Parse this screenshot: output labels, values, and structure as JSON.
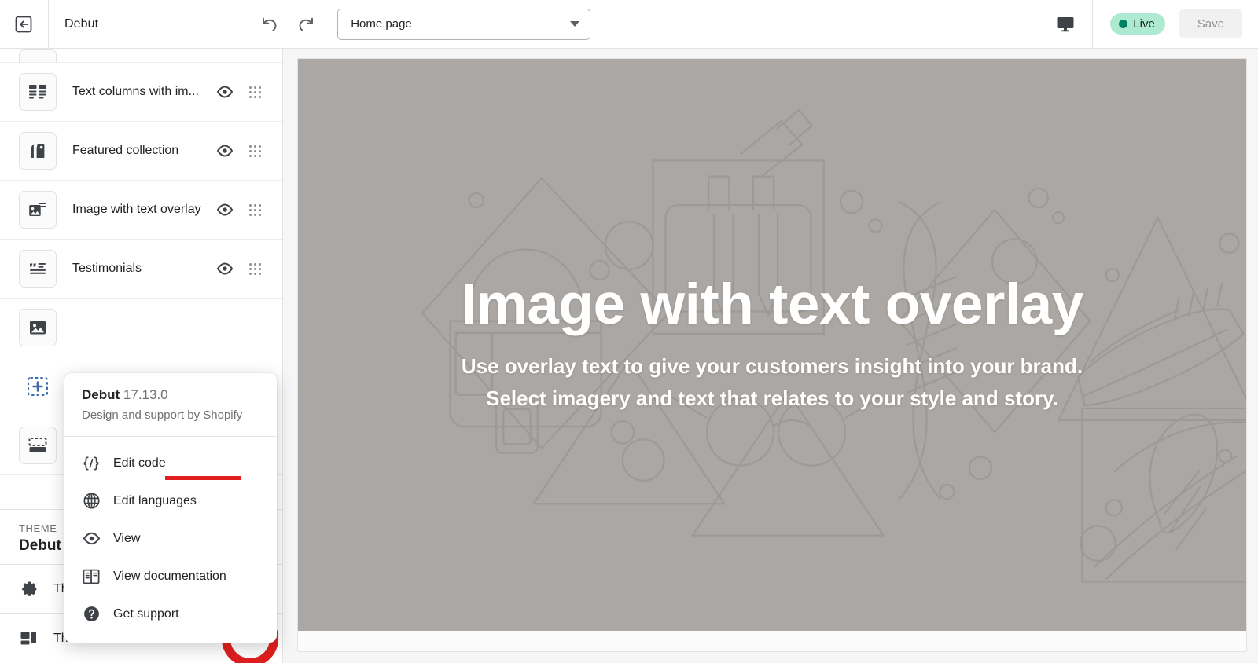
{
  "header": {
    "back_icon": "back-arrow-icon",
    "title": "Debut",
    "undo_icon": "undo-icon",
    "redo_icon": "redo-icon",
    "page_select": {
      "value": "Home page",
      "caret_icon": "chevron-down-icon"
    },
    "device_icon": "desktop-monitor-icon",
    "status": {
      "label": "Live",
      "color": "#008060",
      "background": "#aee9d1"
    },
    "save_label": "Save"
  },
  "sidebar": {
    "sections": [
      {
        "label": "",
        "icon": "slideshow-icon",
        "eye_icon": "eye-icon",
        "grip_icon": "drag-handle-icon",
        "clipped": true
      },
      {
        "label": "Text columns with im...",
        "icon": "text-columns-icon",
        "eye_icon": "eye-icon",
        "grip_icon": "drag-handle-icon"
      },
      {
        "label": "Featured collection",
        "icon": "tag-collection-icon",
        "eye_icon": "eye-icon",
        "grip_icon": "drag-handle-icon"
      },
      {
        "label": "Image with text overlay",
        "icon": "image-with-text-icon",
        "eye_icon": "eye-icon",
        "grip_icon": "drag-handle-icon"
      },
      {
        "label": "Testimonials",
        "icon": "quote-testimonial-icon",
        "eye_icon": "eye-icon",
        "grip_icon": "drag-handle-icon"
      },
      {
        "label": "",
        "icon": "image-icon",
        "eye_icon": "eye-icon",
        "grip_icon": "drag-handle-icon"
      },
      {
        "label": "",
        "icon": "add-section-icon",
        "eye_icon": "",
        "grip_icon": ""
      },
      {
        "label": "",
        "icon": "footer-icon",
        "eye_icon": "",
        "grip_icon": ""
      }
    ],
    "theme": {
      "eyebrow": "THEME",
      "name": "Debut",
      "settings_label": "Th",
      "settings_icon": "gear-icon",
      "actions_label": "Theme actions",
      "actions_icon": "theme-actions-icon",
      "ellipsis_icon": "ellipsis-horizontal-icon"
    }
  },
  "popover": {
    "theme_name": "Debut",
    "version": "17.13.0",
    "subtitle": "Design and support by Shopify",
    "items": [
      {
        "label": "Edit code",
        "icon": "code-braces-icon",
        "highlighted": true
      },
      {
        "label": "Edit languages",
        "icon": "globe-icon",
        "highlighted": false
      },
      {
        "label": "View",
        "icon": "eye-icon",
        "highlighted": false
      },
      {
        "label": "View documentation",
        "icon": "book-icon",
        "highlighted": false
      },
      {
        "label": "Get support",
        "icon": "question-circle-icon",
        "highlighted": false
      }
    ],
    "highlight_color": "#e01e1e"
  },
  "preview": {
    "hero_title": "Image with text overlay",
    "hero_subtitle": "Use overlay text to give your customers insight into your brand. Select imagery and text that relates to your style and story.",
    "background_color": "#aba7a4"
  }
}
